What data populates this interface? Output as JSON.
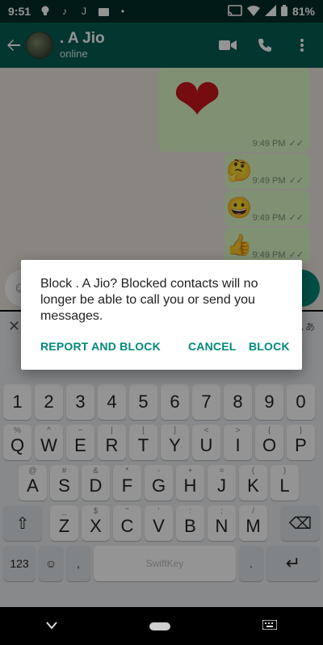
{
  "status_bar": {
    "time": "9:51",
    "battery": "81%"
  },
  "header": {
    "contact_name": ". A Jio",
    "status": "online"
  },
  "messages": [
    {
      "kind": "sticker",
      "emoji": "❤",
      "time": "9:49 PM"
    },
    {
      "kind": "emoji",
      "emoji": "🤔",
      "time": "9:49 PM"
    },
    {
      "kind": "emoji",
      "emoji": "😀",
      "time": "9:49 PM"
    },
    {
      "kind": "emoji",
      "emoji": "👍",
      "time": "9:49 PM"
    }
  ],
  "dialog": {
    "message": "Block . A Jio? Blocked contacts will no longer be able to call you or send you messages.",
    "report_block_label": "REPORT AND BLOCK",
    "cancel_label": "CANCEL",
    "block_label": "BLOCK"
  },
  "keyboard": {
    "numbers": [
      "1",
      "2",
      "3",
      "4",
      "5",
      "6",
      "7",
      "8",
      "9",
      "0"
    ],
    "row1": {
      "keys": [
        "Q",
        "W",
        "E",
        "R",
        "T",
        "Y",
        "U",
        "I",
        "O",
        "P"
      ],
      "hints": [
        "%",
        "^",
        "~",
        "|",
        "[",
        "]",
        "<",
        ">",
        "{",
        "}"
      ]
    },
    "row2": {
      "keys": [
        "A",
        "S",
        "D",
        "F",
        "G",
        "H",
        "J",
        "K",
        "L"
      ],
      "hints": [
        "@",
        "#",
        "&",
        "*",
        "-",
        "+",
        "=",
        "(",
        ")"
      ]
    },
    "row3": {
      "keys": [
        "Z",
        "X",
        "C",
        "V",
        "B",
        "N",
        "M"
      ],
      "hints": [
        "_",
        "$",
        "\"",
        "'",
        ":",
        ";",
        "/"
      ]
    },
    "mode_label": "123",
    "space_label": "SwiftKey",
    "colors": {
      "accent": "#00897b"
    }
  },
  "colors": {
    "header": "#075e54",
    "status_bar": "#052e28",
    "bubble": "#dcf8c6",
    "accent": "#00897b"
  },
  "icons": [
    "back-arrow-icon",
    "video-call-icon",
    "phone-icon",
    "more-vert-icon",
    "wifi-icon",
    "signal-icon",
    "battery-icon",
    "shift-icon",
    "backspace-icon",
    "enter-icon",
    "emoji-icon"
  ]
}
